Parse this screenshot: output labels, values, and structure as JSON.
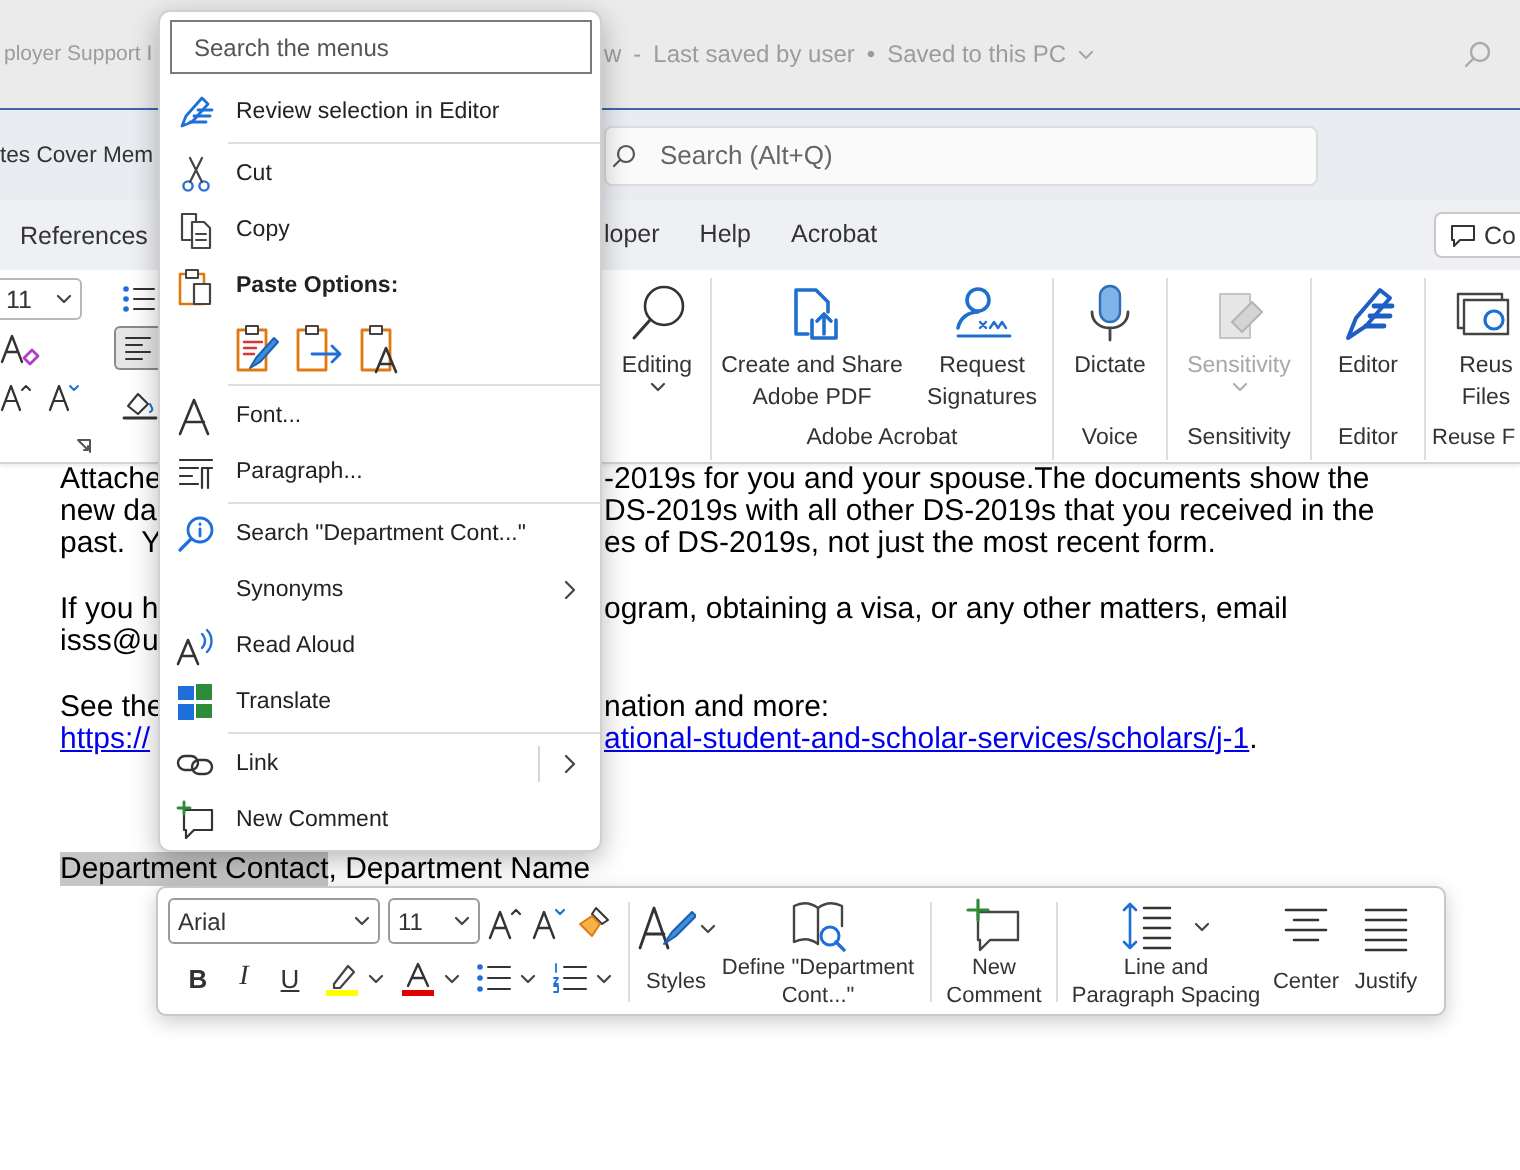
{
  "title_bar": {
    "title_start": "ployer Support I",
    "title_end": "w",
    "separator": "-",
    "save_status": "Last saved by user",
    "bullet": "•",
    "save_location": "Saved to this PC"
  },
  "document_tab": "tes Cover Mem",
  "search": {
    "placeholder": "Search (Alt+Q)"
  },
  "tabs": [
    {
      "label": "References",
      "selected": false
    },
    {
      "label": "loper",
      "selected": false
    },
    {
      "label": "Help",
      "selected": false
    },
    {
      "label": "Acrobat",
      "selected": false
    }
  ],
  "comments_button": "Co",
  "ribbon": {
    "font_size": "11",
    "align_left_pressed": true,
    "groups": [
      {
        "buttons": [
          {
            "kind": "editing",
            "label": "Editing",
            "dropdown": true,
            "disabled": false
          }
        ]
      },
      {
        "label": "Adobe Acrobat",
        "buttons": [
          {
            "kind": "pdf",
            "label": "Create and Share Adobe PDF",
            "dropdown": false,
            "disabled": false
          },
          {
            "kind": "signature",
            "label": "Request Signatures",
            "dropdown": false,
            "disabled": false
          }
        ]
      },
      {
        "label": "Voice",
        "buttons": [
          {
            "kind": "dictate",
            "label": "Dictate",
            "dropdown": false,
            "disabled": false
          }
        ]
      },
      {
        "label": "Sensitivity",
        "buttons": [
          {
            "kind": "sensitivity",
            "label": "Sensitivity",
            "dropdown": true,
            "disabled": true
          }
        ]
      },
      {
        "label": "Editor",
        "buttons": [
          {
            "kind": "editor",
            "label": "Editor",
            "dropdown": false,
            "disabled": false
          }
        ]
      },
      {
        "label": "Reuse F",
        "buttons": [
          {
            "kind": "reuse",
            "label": "Reus Files",
            "dropdown": false,
            "disabled": false
          }
        ]
      }
    ]
  },
  "document": {
    "paragraphs": [
      {
        "lines": [
          {
            "left": [
              {
                "kind": "plain",
                "text": "Attache"
              }
            ],
            "right": [
              {
                "kind": "plain",
                "text": "-2019s for you and your spouse.The documents show the"
              }
            ]
          },
          {
            "left": [
              {
                "kind": "plain",
                "text": "new da"
              }
            ],
            "right": [
              {
                "kind": "plain",
                "text": "DS-2019s with all other DS-2019s that you received in the"
              }
            ]
          },
          {
            "left": [
              {
                "kind": "plain",
                "text": "past.  Y"
              }
            ],
            "right": [
              {
                "kind": "plain",
                "text": "es of DS-2019s, not just the most recent form."
              }
            ]
          }
        ]
      },
      {
        "lines": [
          {
            "left": [
              {
                "kind": "plain",
                "text": "If you h"
              }
            ],
            "right": [
              {
                "kind": "plain",
                "text": "ogram, obtaining a visa, or any other matters, email"
              }
            ]
          },
          {
            "left": [
              {
                "kind": "plain",
                "text": "isss@u"
              }
            ]
          }
        ]
      },
      {
        "lines": [
          {
            "left": [
              {
                "kind": "plain",
                "text": "See the"
              }
            ],
            "right": [
              {
                "kind": "plain",
                "text": "nation and more:"
              }
            ]
          },
          {
            "left": [
              {
                "kind": "link",
                "text": "https://"
              }
            ],
            "right": [
              {
                "kind": "link",
                "text": "ational-student-and-scholar-services/scholars/j-1"
              },
              {
                "kind": "plain",
                "text": "."
              }
            ]
          }
        ]
      },
      {
        "lines": [
          {
            "left": [
              {
                "kind": "highlight",
                "text": "Department Contact"
              },
              {
                "kind": "plain",
                "text": ", Department Name"
              }
            ]
          }
        ]
      }
    ]
  },
  "context_menu": {
    "search": {
      "placeholder": "Search the menus"
    },
    "items": [
      {
        "kind": "command",
        "label": "Review selection in Editor",
        "submenu": false
      },
      {
        "kind": "separator"
      },
      {
        "kind": "command",
        "label": "Cut",
        "submenu": false
      },
      {
        "kind": "command",
        "label": "Copy",
        "submenu": false
      },
      {
        "kind": "header",
        "label": "Paste Options:"
      },
      {
        "kind": "paste"
      },
      {
        "kind": "separator"
      },
      {
        "kind": "command",
        "label": "Font...",
        "submenu": false
      },
      {
        "kind": "command",
        "label": "Paragraph...",
        "submenu": false
      },
      {
        "kind": "separator"
      },
      {
        "kind": "command",
        "label": "Search \"Department Cont...\"",
        "submenu": false
      },
      {
        "kind": "command",
        "label": "Synonyms",
        "submenu": true
      },
      {
        "kind": "command",
        "label": "Read Aloud",
        "submenu": false
      },
      {
        "kind": "command",
        "label": "Translate",
        "submenu": false
      },
      {
        "kind": "separator"
      },
      {
        "kind": "command",
        "label": "Link",
        "submenu": true
      },
      {
        "kind": "command",
        "label": "New Comment",
        "submenu": false
      }
    ]
  },
  "mini_toolbar": {
    "font": "Arial",
    "size": "11",
    "bold": "B",
    "italic": "I",
    "underline": "U",
    "groups": [
      {
        "buttons": [
          {
            "kind": "styles",
            "label": "Styles",
            "dropdown": true
          },
          {
            "kind": "define",
            "label": "Define \"Department Cont...\"",
            "dropdown": false
          }
        ]
      },
      {
        "buttons": [
          {
            "kind": "comment",
            "label": "New Comment",
            "dropdown": false
          }
        ]
      },
      {
        "buttons": [
          {
            "kind": "spacing",
            "label": "Line and Paragraph Spacing",
            "dropdown": true
          },
          {
            "kind": "center",
            "label": "Center",
            "dropdown": false
          },
          {
            "kind": "justify",
            "label": "Justify",
            "dropdown": false
          }
        ]
      }
    ]
  }
}
